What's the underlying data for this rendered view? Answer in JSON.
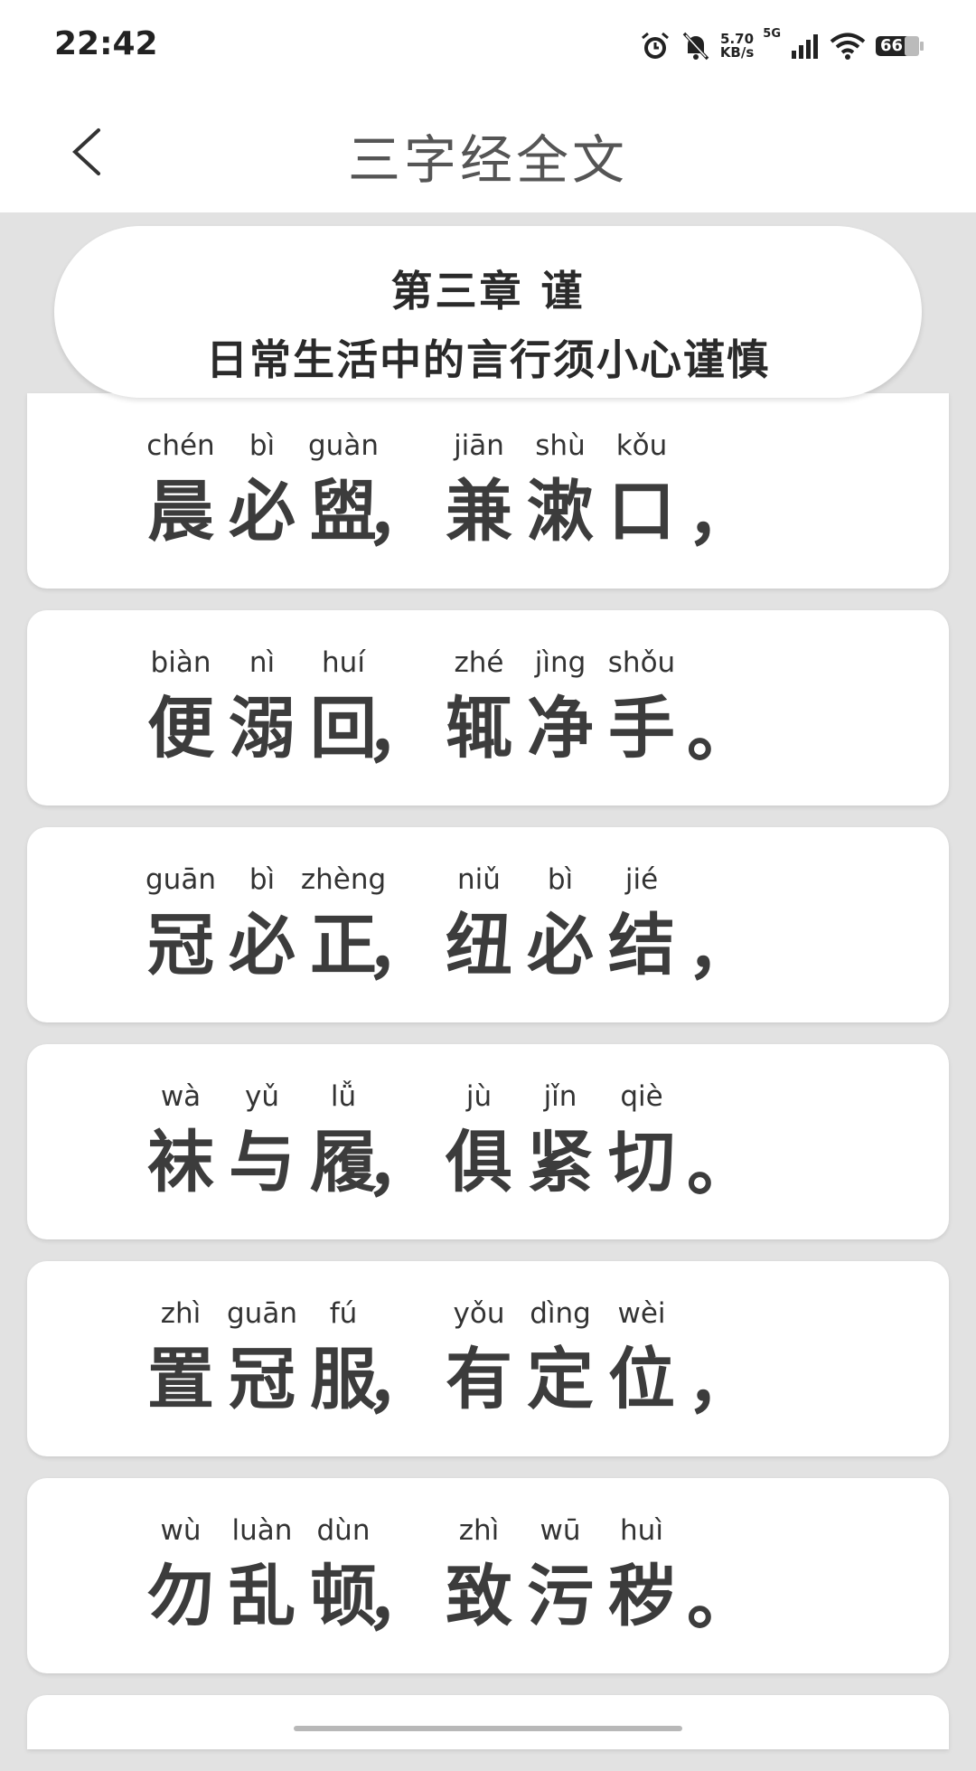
{
  "status_bar": {
    "time": "22:42",
    "net_speed_value": "5.70",
    "net_speed_unit": "KB/s",
    "network_type": "5G",
    "battery": "66",
    "icons": [
      "alarm-icon",
      "mute-bell-icon",
      "signal-icon",
      "wifi-icon",
      "battery-icon"
    ]
  },
  "header": {
    "title": "三字经全文",
    "back_icon": "chevron-left-icon"
  },
  "chapter": {
    "title": "第三章  谨",
    "subtitle": "日常生活中的言行须小心谨慎"
  },
  "verses": [
    {
      "chars": [
        {
          "pinyin": "chén",
          "hanzi": "晨"
        },
        {
          "pinyin": "bì",
          "hanzi": "必"
        },
        {
          "pinyin": "guàn",
          "hanzi": "盥"
        },
        {
          "pinyin": "jiān",
          "hanzi": "兼"
        },
        {
          "pinyin": "shù",
          "hanzi": "漱"
        },
        {
          "pinyin": "kǒu",
          "hanzi": "口"
        }
      ],
      "mid_punct": "，",
      "end_punct": "，"
    },
    {
      "chars": [
        {
          "pinyin": "biàn",
          "hanzi": "便"
        },
        {
          "pinyin": "nì",
          "hanzi": "溺"
        },
        {
          "pinyin": "huí",
          "hanzi": "回"
        },
        {
          "pinyin": "zhé",
          "hanzi": "辄"
        },
        {
          "pinyin": "jìng",
          "hanzi": "净"
        },
        {
          "pinyin": "shǒu",
          "hanzi": "手"
        }
      ],
      "mid_punct": "，",
      "end_punct": "。"
    },
    {
      "chars": [
        {
          "pinyin": "guān",
          "hanzi": "冠"
        },
        {
          "pinyin": "bì",
          "hanzi": "必"
        },
        {
          "pinyin": "zhèng",
          "hanzi": "正"
        },
        {
          "pinyin": "niǔ",
          "hanzi": "纽"
        },
        {
          "pinyin": "bì",
          "hanzi": "必"
        },
        {
          "pinyin": "jié",
          "hanzi": "结"
        }
      ],
      "mid_punct": "，",
      "end_punct": "，"
    },
    {
      "chars": [
        {
          "pinyin": "wà",
          "hanzi": "袜"
        },
        {
          "pinyin": "yǔ",
          "hanzi": "与"
        },
        {
          "pinyin": "lǚ",
          "hanzi": "履"
        },
        {
          "pinyin": "jù",
          "hanzi": "俱"
        },
        {
          "pinyin": "jǐn",
          "hanzi": "紧"
        },
        {
          "pinyin": "qiè",
          "hanzi": "切"
        }
      ],
      "mid_punct": "，",
      "end_punct": "。"
    },
    {
      "chars": [
        {
          "pinyin": "zhì",
          "hanzi": "置"
        },
        {
          "pinyin": "guān",
          "hanzi": "冠"
        },
        {
          "pinyin": "fú",
          "hanzi": "服"
        },
        {
          "pinyin": "yǒu",
          "hanzi": "有"
        },
        {
          "pinyin": "dìng",
          "hanzi": "定"
        },
        {
          "pinyin": "wèi",
          "hanzi": "位"
        }
      ],
      "mid_punct": "，",
      "end_punct": "，"
    },
    {
      "chars": [
        {
          "pinyin": "wù",
          "hanzi": "勿"
        },
        {
          "pinyin": "luàn",
          "hanzi": "乱"
        },
        {
          "pinyin": "dùn",
          "hanzi": "顿"
        },
        {
          "pinyin": "zhì",
          "hanzi": "致"
        },
        {
          "pinyin": "wū",
          "hanzi": "污"
        },
        {
          "pinyin": "huì",
          "hanzi": "秽"
        }
      ],
      "mid_punct": "，",
      "end_punct": "。"
    }
  ]
}
